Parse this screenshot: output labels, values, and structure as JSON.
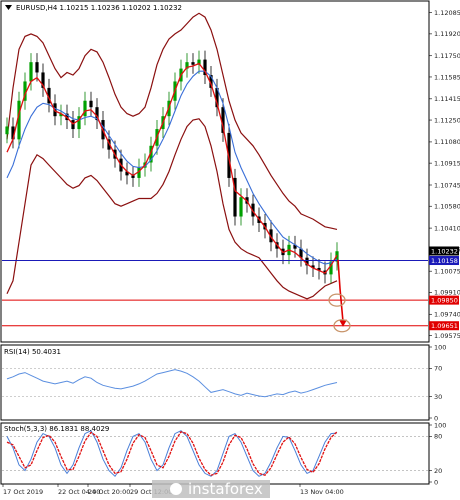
{
  "main_panel": {
    "title": "EURUSD,H4  1.10215 1.10236 1.10202 1.10232",
    "y_ticks": [
      "1.12085",
      "1.11920",
      "1.11750",
      "1.11585",
      "1.11415",
      "1.11250",
      "1.11080",
      "1.10915",
      "1.10745",
      "1.10580",
      "1.10410",
      "1.10245",
      "1.10075",
      "1.09910",
      "1.09740",
      "1.09575"
    ],
    "price_tags": [
      {
        "label": "1.10232",
        "color": "#000000",
        "text_color": "#ffffff"
      },
      {
        "label": "1.10158",
        "color": "#1a1ab8",
        "text_color": "#ffffff"
      },
      {
        "label": "1.09850",
        "color": "#e00000",
        "text_color": "#ffffff"
      },
      {
        "label": "1.09651",
        "color": "#e00000",
        "text_color": "#ffffff"
      }
    ]
  },
  "rsi_panel": {
    "title": "RSI(14) 50.4031",
    "y_ticks": [
      "100",
      "70",
      "30",
      "0"
    ]
  },
  "stoch_panel": {
    "title": "Stoch(5,3,3) 86.1831 88.4029",
    "y_ticks": [
      "100",
      "80",
      "20",
      "0"
    ]
  },
  "x_axis": {
    "ticks": [
      "17 Oct 2019",
      "22 Oct 04:00",
      "24 Oct 20:00",
      "29 Oct 12:00",
      "13 Nov 04:00"
    ]
  },
  "watermark": {
    "text": "instaforex"
  },
  "chart_data": [
    {
      "type": "candlestick",
      "title": "EURUSD,H4  1.10215 1.10236 1.10202 1.10232",
      "ylim": [
        1.0954,
        1.1216
      ],
      "close": [
        1.112,
        1.111,
        1.114,
        1.1155,
        1.117,
        1.1162,
        1.115,
        1.1138,
        1.1128,
        1.113,
        1.1125,
        1.1118,
        1.1128,
        1.114,
        1.1135,
        1.1125,
        1.111,
        1.1102,
        1.1095,
        1.1085,
        1.1082,
        1.108,
        1.1088,
        1.1092,
        1.1105,
        1.1118,
        1.1128,
        1.114,
        1.1155,
        1.1165,
        1.117,
        1.1168,
        1.1172,
        1.116,
        1.115,
        1.1135,
        1.1115,
        1.108,
        1.105,
        1.1065,
        1.106,
        1.105,
        1.1045,
        1.104,
        1.103,
        1.1025,
        1.102,
        1.1028,
        1.1025,
        1.1018,
        1.1012,
        1.101,
        1.1008,
        1.1005,
        1.1015,
        1.1023
      ],
      "band_upper": [
        1.111,
        1.115,
        1.118,
        1.119,
        1.1192,
        1.119,
        1.1185,
        1.1175,
        1.1165,
        1.1158,
        1.1162,
        1.116,
        1.1165,
        1.1175,
        1.118,
        1.1178,
        1.117,
        1.1158,
        1.1145,
        1.1135,
        1.113,
        1.1128,
        1.113,
        1.1135,
        1.115,
        1.1168,
        1.118,
        1.1188,
        1.1192,
        1.1195,
        1.12,
        1.1205,
        1.1208,
        1.1205,
        1.1195,
        1.118,
        1.116,
        1.114,
        1.1125,
        1.1115,
        1.111,
        1.1105,
        1.1098,
        1.109,
        1.1082,
        1.1075,
        1.1068,
        1.1062,
        1.1058,
        1.1052,
        1.105,
        1.1048,
        1.1045,
        1.1042,
        1.1041,
        1.104
      ],
      "band_lower": [
        1.099,
        1.1,
        1.103,
        1.106,
        1.109,
        1.1098,
        1.1095,
        1.109,
        1.1085,
        1.108,
        1.1075,
        1.1072,
        1.1074,
        1.108,
        1.1082,
        1.1078,
        1.1072,
        1.1066,
        1.106,
        1.1058,
        1.106,
        1.1062,
        1.1064,
        1.1064,
        1.1064,
        1.1068,
        1.1075,
        1.1085,
        1.1098,
        1.111,
        1.112,
        1.1125,
        1.1126,
        1.112,
        1.1105,
        1.1085,
        1.106,
        1.104,
        1.103,
        1.1025,
        1.1022,
        1.102,
        1.1018,
        1.1012,
        1.1006,
        1.1,
        1.0995,
        1.0992,
        1.099,
        1.0988,
        1.0986,
        1.0988,
        1.0992,
        1.0996,
        1.0998,
        1.1
      ],
      "ma_fast": [
        1.11,
        1.111,
        1.113,
        1.1145,
        1.1155,
        1.1158,
        1.1152,
        1.1142,
        1.1132,
        1.113,
        1.1127,
        1.1122,
        1.1125,
        1.1132,
        1.1133,
        1.1128,
        1.1117,
        1.1107,
        1.1098,
        1.109,
        1.1085,
        1.1082,
        1.1085,
        1.109,
        1.11,
        1.1112,
        1.1123,
        1.1135,
        1.1148,
        1.116,
        1.1166,
        1.1167,
        1.1169,
        1.1163,
        1.1153,
        1.1138,
        1.112,
        1.1095,
        1.107,
        1.1066,
        1.1062,
        1.1054,
        1.1048,
        1.1042,
        1.1034,
        1.1028,
        1.1022,
        1.1024,
        1.1022,
        1.1018,
        1.1013,
        1.101,
        1.1008,
        1.1006,
        1.1012,
        1.102
      ],
      "ma_slow": [
        1.108,
        1.109,
        1.1105,
        1.1118,
        1.1128,
        1.1135,
        1.1138,
        1.1137,
        1.1134,
        1.1132,
        1.1129,
        1.1126,
        1.1125,
        1.1127,
        1.1128,
        1.1126,
        1.112,
        1.1113,
        1.1106,
        1.1099,
        1.1093,
        1.1089,
        1.1088,
        1.1089,
        1.1094,
        1.1101,
        1.111,
        1.112,
        1.1132,
        1.1144,
        1.1153,
        1.1159,
        1.1163,
        1.1163,
        1.1159,
        1.115,
        1.1138,
        1.112,
        1.11,
        1.1088,
        1.1078,
        1.1068,
        1.106,
        1.1053,
        1.1046,
        1.104,
        1.1034,
        1.1031,
        1.1028,
        1.1025,
        1.1021,
        1.1018,
        1.1015,
        1.1013,
        1.1014,
        1.1017
      ],
      "horizontal_levels": [
        1.10158,
        1.0985,
        1.09651
      ],
      "annotations": [
        {
          "kind": "arrow",
          "from": 1.1018,
          "to": 1.09651
        },
        {
          "kind": "circle",
          "at": 1.0985
        },
        {
          "kind": "circle",
          "at": 1.09651
        }
      ]
    },
    {
      "type": "line",
      "title": "RSI(14) 50.4031",
      "ylim": [
        0,
        100
      ],
      "levels": [
        70,
        30
      ],
      "values": [
        55,
        58,
        62,
        64,
        60,
        56,
        52,
        50,
        48,
        50,
        52,
        49,
        54,
        58,
        56,
        50,
        46,
        44,
        42,
        41,
        43,
        45,
        48,
        52,
        57,
        62,
        64,
        66,
        68,
        66,
        63,
        58,
        52,
        44,
        36,
        38,
        40,
        37,
        34,
        32,
        35,
        33,
        31,
        30,
        32,
        34,
        33,
        36,
        38,
        35,
        37,
        40,
        43,
        46,
        48,
        50
      ]
    },
    {
      "type": "line",
      "title": "Stoch(5,3,3) 86.1831 88.4029",
      "ylim": [
        0,
        100
      ],
      "levels": [
        80,
        20
      ],
      "series": [
        {
          "name": "main",
          "values": [
            80,
            60,
            30,
            20,
            40,
            70,
            85,
            80,
            60,
            30,
            15,
            30,
            60,
            85,
            90,
            70,
            40,
            20,
            10,
            25,
            55,
            80,
            85,
            70,
            40,
            20,
            30,
            60,
            85,
            90,
            80,
            55,
            30,
            15,
            10,
            20,
            50,
            80,
            85,
            70,
            45,
            20,
            10,
            15,
            35,
            60,
            80,
            78,
            55,
            30,
            15,
            20,
            45,
            70,
            85,
            86
          ]
        },
        {
          "name": "signal",
          "values": [
            70,
            65,
            45,
            25,
            30,
            55,
            78,
            82,
            70,
            45,
            22,
            22,
            45,
            72,
            87,
            80,
            55,
            30,
            15,
            18,
            40,
            68,
            83,
            78,
            55,
            30,
            25,
            45,
            72,
            88,
            85,
            68,
            42,
            22,
            12,
            15,
            35,
            65,
            82,
            78,
            58,
            32,
            15,
            12,
            25,
            48,
            70,
            79,
            67,
            43,
            22,
            17,
            32,
            58,
            78,
            88
          ]
        }
      ]
    }
  ]
}
